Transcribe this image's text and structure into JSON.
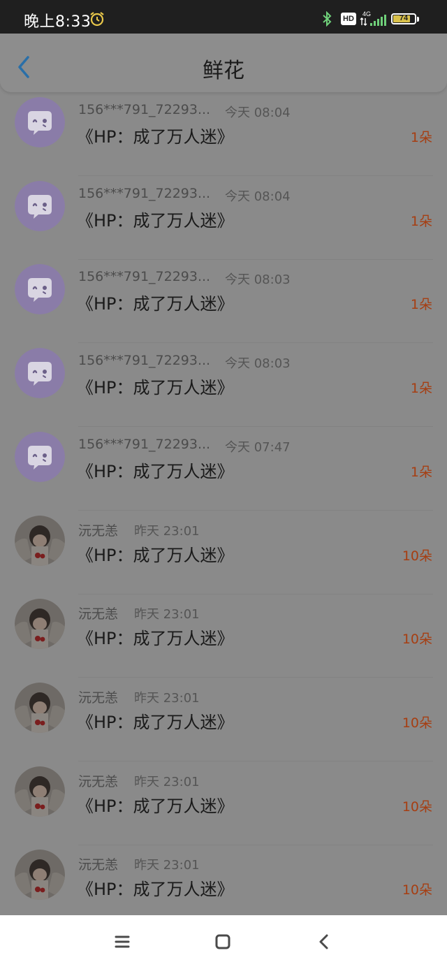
{
  "status_bar": {
    "time": "晚上8:33",
    "hd_label": "HD",
    "network_label": "4G",
    "battery_level": "74"
  },
  "header": {
    "title": "鲜花"
  },
  "list": {
    "items": [
      {
        "avatar": "chat-bubble-avatar",
        "username": "156***791_72293...",
        "time": "今天 08:04",
        "book": "《HP：成了万人迷》",
        "count": "1朵"
      },
      {
        "avatar": "chat-bubble-avatar",
        "username": "156***791_72293...",
        "time": "今天 08:04",
        "book": "《HP：成了万人迷》",
        "count": "1朵"
      },
      {
        "avatar": "chat-bubble-avatar",
        "username": "156***791_72293...",
        "time": "今天 08:03",
        "book": "《HP：成了万人迷》",
        "count": "1朵"
      },
      {
        "avatar": "chat-bubble-avatar",
        "username": "156***791_72293...",
        "time": "今天 08:03",
        "book": "《HP：成了万人迷》",
        "count": "1朵"
      },
      {
        "avatar": "chat-bubble-avatar",
        "username": "156***791_72293...",
        "time": "今天 07:47",
        "book": "《HP：成了万人迷》",
        "count": "1朵"
      },
      {
        "avatar": "photo-avatar",
        "username": "沅无恙",
        "time": "昨天 23:01",
        "book": "《HP：成了万人迷》",
        "count": "10朵"
      },
      {
        "avatar": "photo-avatar",
        "username": "沅无恙",
        "time": "昨天 23:01",
        "book": "《HP：成了万人迷》",
        "count": "10朵"
      },
      {
        "avatar": "photo-avatar",
        "username": "沅无恙",
        "time": "昨天 23:01",
        "book": "《HP：成了万人迷》",
        "count": "10朵"
      },
      {
        "avatar": "photo-avatar",
        "username": "沅无恙",
        "time": "昨天 23:01",
        "book": "《HP：成了万人迷》",
        "count": "10朵"
      },
      {
        "avatar": "photo-avatar",
        "username": "沅无恙",
        "time": "昨天 23:01",
        "book": "《HP：成了万人迷》",
        "count": "10朵"
      }
    ]
  },
  "nav_bar": {
    "buttons": [
      "menu-icon",
      "home-icon",
      "back-icon"
    ]
  },
  "colors": {
    "count_accent": "#a63e12",
    "chat_avatar_bg": "#8a7ca8",
    "back_arrow": "#2a6fa8"
  }
}
